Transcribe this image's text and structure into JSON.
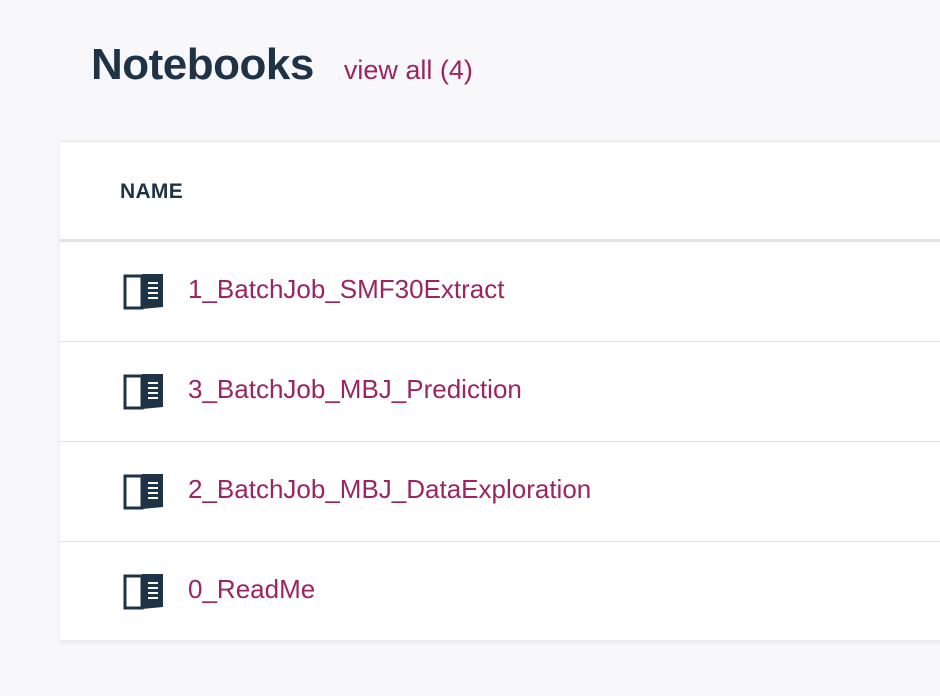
{
  "header": {
    "title": "Notebooks",
    "view_all_label": "view all (4)"
  },
  "table": {
    "column_name_label": "NAME",
    "rows": [
      {
        "name": "1_BatchJob_SMF30Extract",
        "icon": "open-book-icon"
      },
      {
        "name": "3_BatchJob_MBJ_Prediction",
        "icon": "open-book-icon"
      },
      {
        "name": "2_BatchJob_MBJ_DataExploration",
        "icon": "open-book-icon"
      },
      {
        "name": "0_ReadMe",
        "icon": "open-book-icon"
      }
    ]
  },
  "colors": {
    "title": "#1f3347",
    "link": "#9b2463",
    "background": "#f8f8fa"
  }
}
